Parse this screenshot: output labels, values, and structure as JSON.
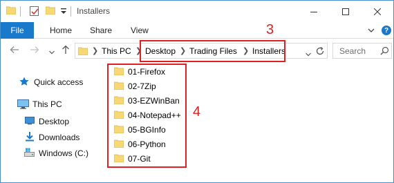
{
  "window": {
    "title": "Installers"
  },
  "ribbon": {
    "file": "File",
    "tabs": [
      "Home",
      "Share",
      "View"
    ],
    "help": "?"
  },
  "address": {
    "breadcrumbs": [
      "This PC",
      "Desktop",
      "Trading Files",
      "Installers"
    ]
  },
  "search": {
    "placeholder": "Search"
  },
  "nav": {
    "quick_access": "Quick access",
    "this_pc": "This PC",
    "desktop": "Desktop",
    "downloads": "Downloads",
    "windows_c": "Windows (C:)"
  },
  "files": [
    {
      "name": "01-Firefox"
    },
    {
      "name": "02-7Zip"
    },
    {
      "name": "03-EZWinBan"
    },
    {
      "name": "04-Notepad++"
    },
    {
      "name": "05-BGInfo"
    },
    {
      "name": "06-Python"
    },
    {
      "name": "07-Git"
    }
  ],
  "annotations": {
    "address_label": "3",
    "files_label": "4"
  },
  "colors": {
    "accent": "#1979ca",
    "annotation": "#e02020",
    "folder": "#f8d775"
  }
}
